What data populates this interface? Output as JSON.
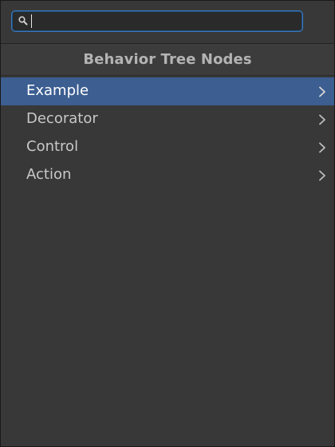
{
  "search": {
    "value": "",
    "icon": "search-icon"
  },
  "header": {
    "title": "Behavior Tree Nodes"
  },
  "items": [
    {
      "label": "Example",
      "selected": true,
      "icon": "chevron-right-icon"
    },
    {
      "label": "Decorator",
      "selected": false,
      "icon": "chevron-right-icon"
    },
    {
      "label": "Control",
      "selected": false,
      "icon": "chevron-right-icon"
    },
    {
      "label": "Action",
      "selected": false,
      "icon": "chevron-right-icon"
    }
  ],
  "colors": {
    "background": "#383838",
    "selection": "#3c5e91",
    "search_focus": "#3a79bb"
  }
}
